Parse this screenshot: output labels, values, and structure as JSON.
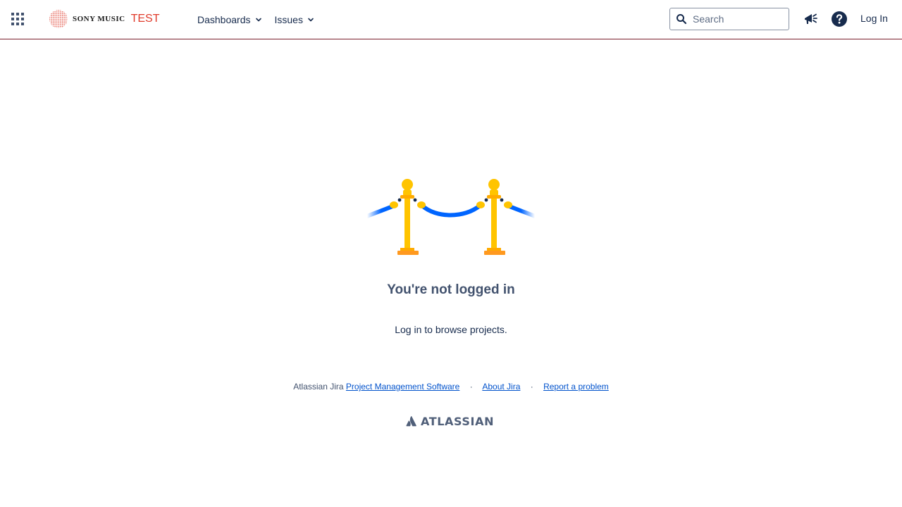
{
  "header": {
    "logo_brand": "SONY MUSIC",
    "logo_env": "TEST",
    "nav": [
      {
        "label": "Dashboards"
      },
      {
        "label": "Issues"
      }
    ],
    "search": {
      "placeholder": "Search",
      "value": ""
    },
    "login_label": "Log In",
    "icons": {
      "app_switcher": "app-switcher-icon",
      "announcements": "megaphone-icon",
      "help": "help-icon"
    }
  },
  "main": {
    "title": "You're not logged in",
    "subtitle": "Log in to browse projects."
  },
  "footer": {
    "prefix": "Atlassian Jira",
    "links": [
      {
        "label": "Project Management Software"
      },
      {
        "label": "About Jira"
      },
      {
        "label": "Report a problem"
      }
    ],
    "separator": "·",
    "brand": "ATLASSIAN"
  },
  "colors": {
    "accent_border": "#7a1f2b",
    "link": "#0052cc",
    "logo_red": "#e03b2b",
    "post_gold": "#ffc400",
    "rope_blue": "#0065ff"
  }
}
